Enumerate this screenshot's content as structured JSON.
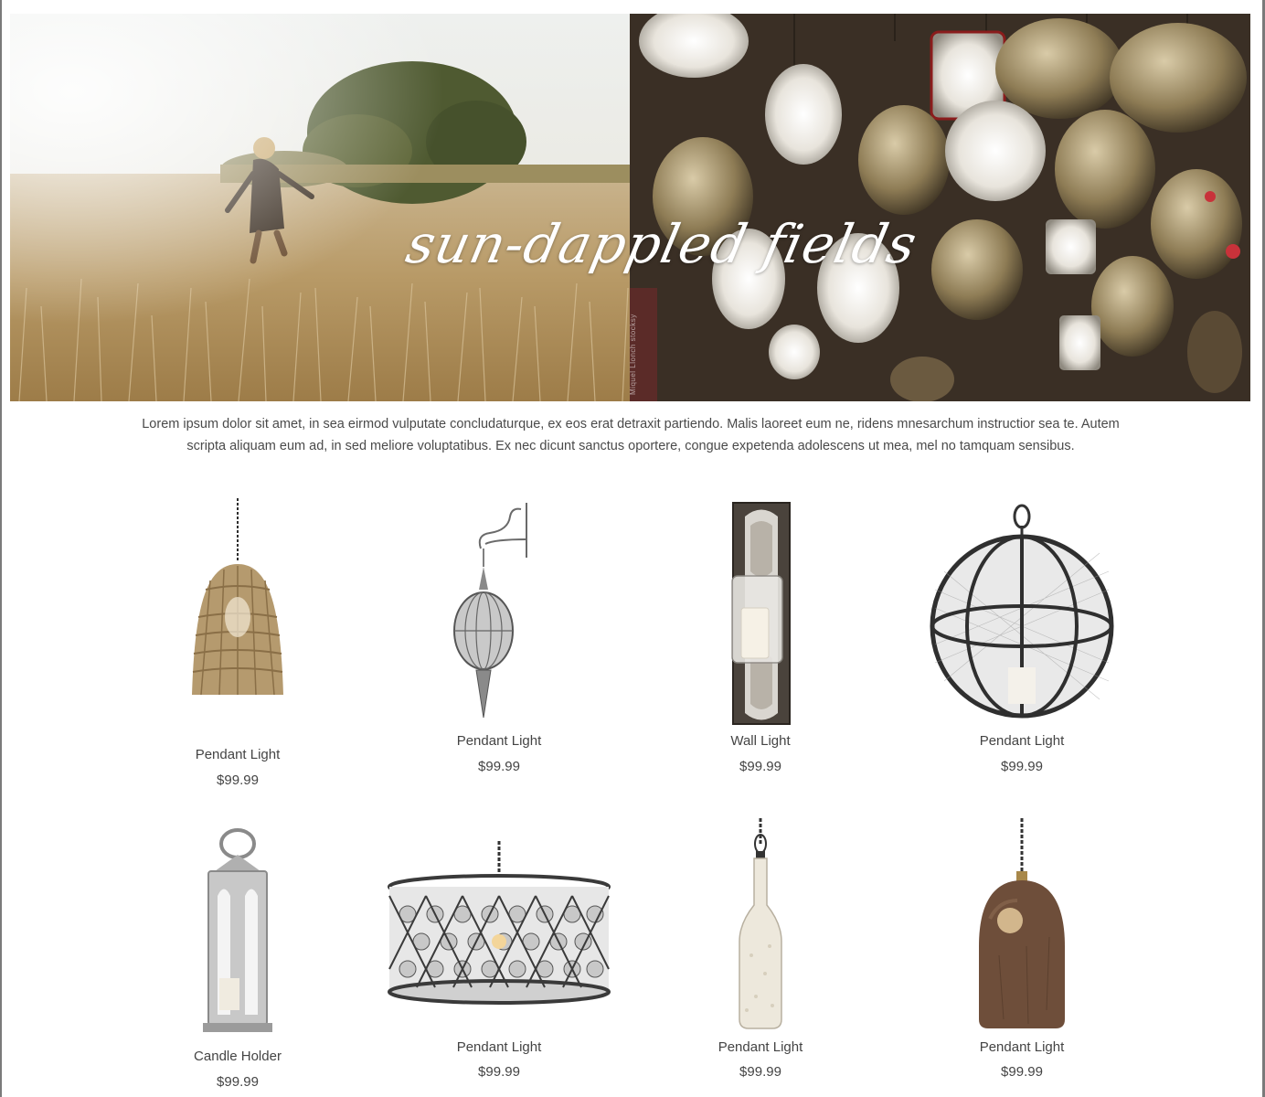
{
  "hero": {
    "title": "sun-dappled fields",
    "credit": "Miquel Llonch  stocksy"
  },
  "intro": {
    "text": "Lorem ipsum dolor sit amet, in sea eirmod vulputate concludaturque, ex eos erat detraxit partiendo. Malis laoreet eum ne, ridens mnesarchum instructior sea te. Autem scripta aliquam eum ad, in sed meliore voluptatibus. Ex nec dicunt sanctus oportere, congue expetenda adolescens ut mea, mel no tamquam sensibus."
  },
  "products": [
    {
      "name": "Pendant Light",
      "price": "$99.99",
      "icon": "rattan-pendant-light-image"
    },
    {
      "name": "Pendant Light",
      "price": "$99.99",
      "icon": "moroccan-hanging-lantern-image"
    },
    {
      "name": "Wall Light",
      "price": "$99.99",
      "icon": "wall-sconce-image"
    },
    {
      "name": "Pendant Light",
      "price": "$99.99",
      "icon": "globe-cage-pendant-image"
    },
    {
      "name": "Candle Holder",
      "price": "$99.99",
      "icon": "steel-lantern-image"
    },
    {
      "name": "Pendant Light",
      "price": "$99.99",
      "icon": "crystal-drum-chandelier-image"
    },
    {
      "name": "Pendant Light",
      "price": "$99.99",
      "icon": "glass-bottle-pendant-image"
    },
    {
      "name": "Pendant Light",
      "price": "$99.99",
      "icon": "bronze-dome-pendant-image"
    }
  ]
}
